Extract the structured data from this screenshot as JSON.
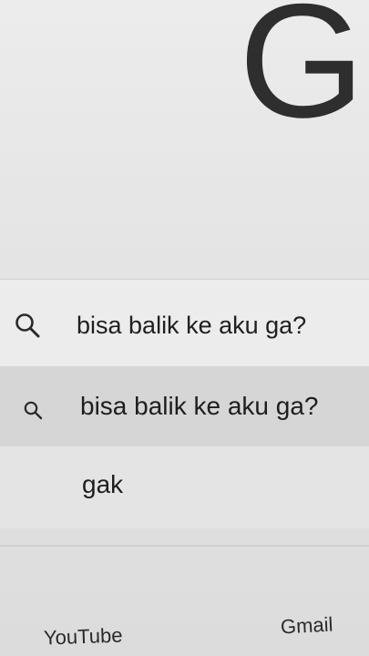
{
  "logo": {
    "letter": "G"
  },
  "search": {
    "value": "bisa balik ke aku ga?",
    "icon": "search-icon"
  },
  "suggestions": [
    {
      "text": "bisa balik ke aku ga?",
      "icon": "search-icon",
      "highlighted": true
    },
    {
      "text": "gak",
      "icon": "",
      "highlighted": false
    }
  ],
  "footer": {
    "links": [
      {
        "label": "YouTube"
      },
      {
        "label": "Gmail"
      }
    ]
  },
  "colors": {
    "background": "#e6e6e6",
    "logo": "#2e2e2e",
    "highlight_row": "#d6d6d6",
    "text": "#1f1f1f"
  }
}
